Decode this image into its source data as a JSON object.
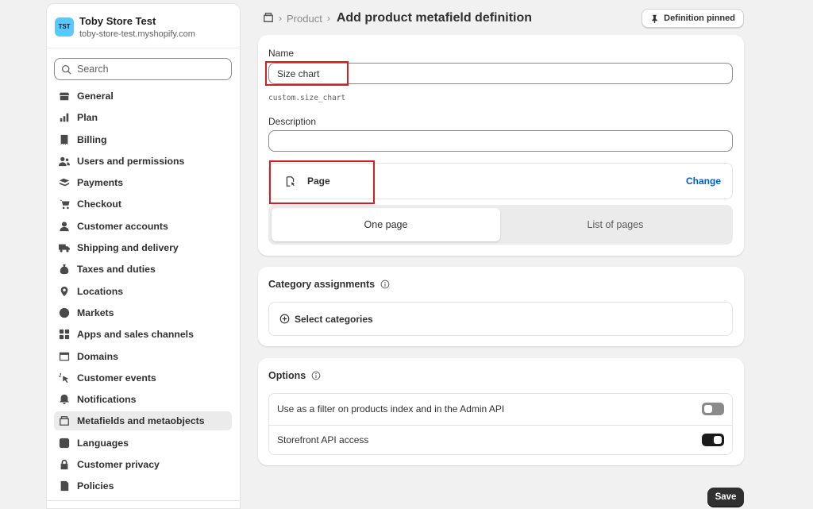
{
  "store": {
    "avatar": "TST",
    "name": "Toby Store Test",
    "url": "toby-store-test.myshopify.com"
  },
  "search": {
    "placeholder": "Search"
  },
  "sidebar": {
    "items": [
      {
        "label": "General",
        "icon": "store-icon"
      },
      {
        "label": "Plan",
        "icon": "plan-icon"
      },
      {
        "label": "Billing",
        "icon": "billing-icon"
      },
      {
        "label": "Users and permissions",
        "icon": "users-icon"
      },
      {
        "label": "Payments",
        "icon": "payments-icon"
      },
      {
        "label": "Checkout",
        "icon": "cart-icon"
      },
      {
        "label": "Customer accounts",
        "icon": "person-icon"
      },
      {
        "label": "Shipping and delivery",
        "icon": "truck-icon"
      },
      {
        "label": "Taxes and duties",
        "icon": "money-bag-icon"
      },
      {
        "label": "Locations",
        "icon": "location-pin-icon"
      },
      {
        "label": "Markets",
        "icon": "globe-icon"
      },
      {
        "label": "Apps and sales channels",
        "icon": "apps-icon"
      },
      {
        "label": "Domains",
        "icon": "domain-icon"
      },
      {
        "label": "Customer events",
        "icon": "cursor-click-icon"
      },
      {
        "label": "Notifications",
        "icon": "bell-icon"
      },
      {
        "label": "Metafields and metaobjects",
        "icon": "metafields-icon",
        "active": true
      },
      {
        "label": "Languages",
        "icon": "language-icon"
      },
      {
        "label": "Customer privacy",
        "icon": "lock-icon"
      },
      {
        "label": "Policies",
        "icon": "policy-icon"
      }
    ]
  },
  "header": {
    "breadcrumb": "Product",
    "title": "Add product metafield definition",
    "pinned_label": "Definition pinned"
  },
  "form": {
    "name_label": "Name",
    "name_value": "Size chart",
    "namespace_key": "custom.size_chart",
    "description_label": "Description",
    "description_value": "",
    "type_label": "Page",
    "change_label": "Change",
    "seg_one": "One page",
    "seg_list": "List of pages"
  },
  "category": {
    "title": "Category assignments",
    "select_label": "Select categories"
  },
  "options": {
    "title": "Options",
    "filter_label": "Use as a filter on products index and in the Admin API",
    "filter_on": false,
    "storefront_label": "Storefront API access",
    "storefront_on": true
  },
  "save_label": "Save",
  "colors": {
    "highlight": "#d21f26",
    "link": "#005bd3",
    "primary_button": "#303030"
  }
}
